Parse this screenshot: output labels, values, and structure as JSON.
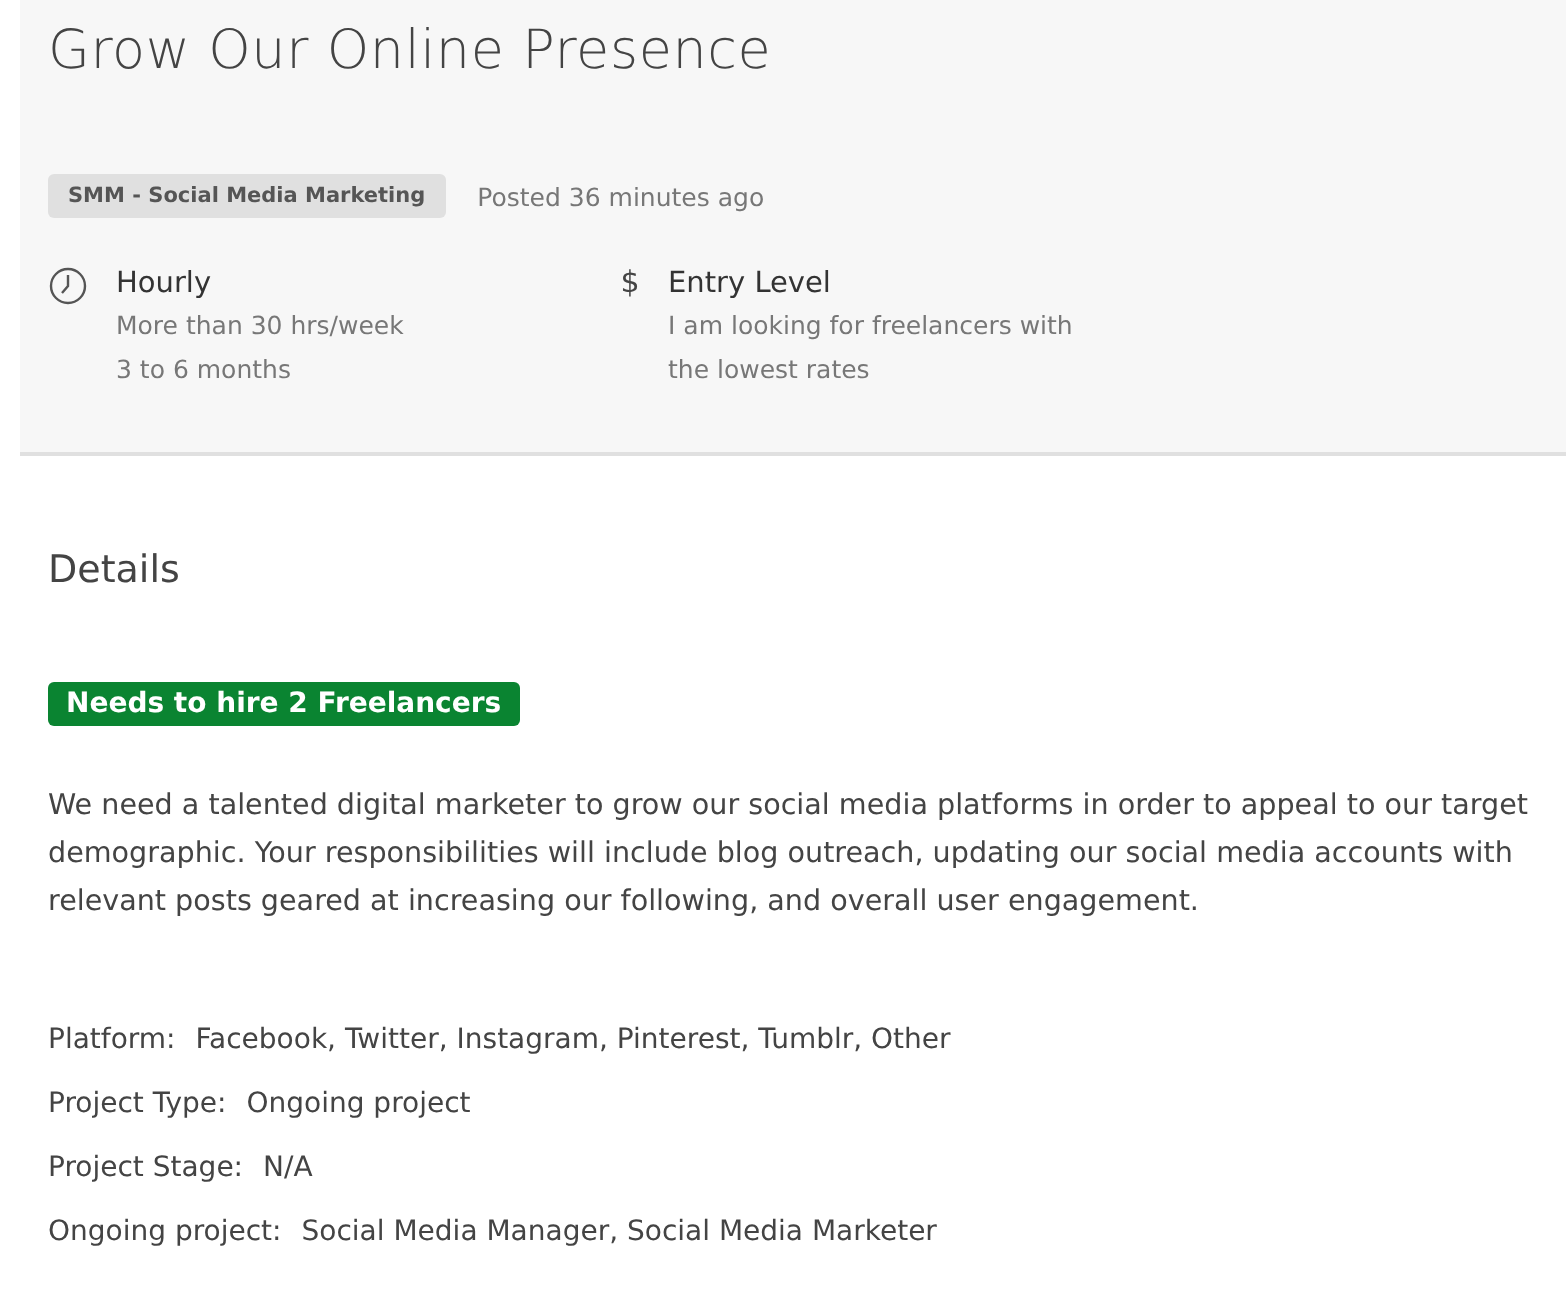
{
  "title": "Grow Our Online Presence",
  "category_tag": "SMM - Social Media Marketing",
  "posted": "Posted 36 minutes ago",
  "meta": [
    {
      "kind": "clock",
      "heading": "Hourly",
      "lines": [
        "More than 30 hrs/week",
        "3 to 6 months"
      ]
    },
    {
      "kind": "symbol",
      "symbol": "$",
      "heading": "Entry Level",
      "lines": [
        "I am looking for freelancers with",
        "the lowest rates"
      ]
    }
  ],
  "details": {
    "heading": "Details",
    "badge": "Needs to hire 2 Freelancers",
    "description": "We need a talented digital marketer to grow our social media platforms in order to appeal to our target demographic. Your responsibilities will include blog outreach, updating our social media accounts with relevant posts geared at increasing our following, and overall user engagement.",
    "properties": [
      {
        "label": "Platform:",
        "value": "Facebook, Twitter, Instagram, Pinterest, Tumblr, Other"
      },
      {
        "label": "Project Type:",
        "value": "Ongoing project"
      },
      {
        "label": "Project Stage:",
        "value": "N/A"
      },
      {
        "label": "Ongoing project:",
        "value": "Social Media Manager, Social Media Marketer"
      }
    ]
  }
}
